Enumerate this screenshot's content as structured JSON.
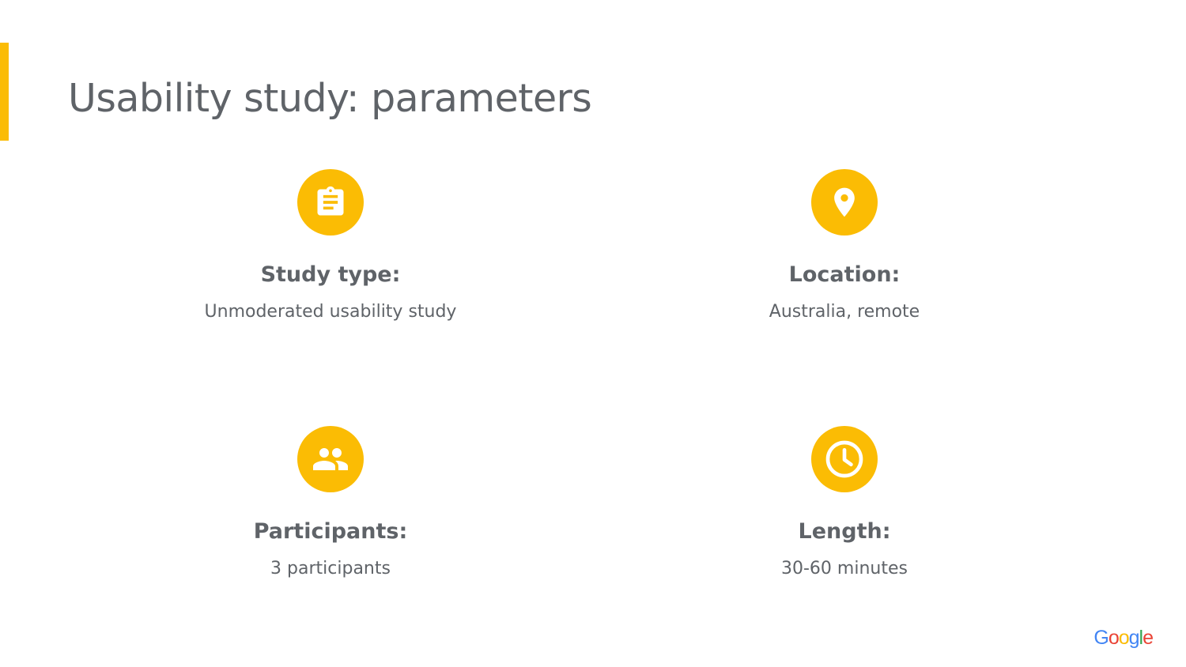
{
  "slide": {
    "title": "Usability study: parameters",
    "accent_color": "#fbbc04"
  },
  "parameters": [
    {
      "label": "Study type:",
      "value": "Unmoderated usability study",
      "icon": "clipboard-icon"
    },
    {
      "label": "Location:",
      "value": "Australia, remote",
      "icon": "location-pin-icon"
    },
    {
      "label": "Participants:",
      "value": "3 participants",
      "icon": "people-icon"
    },
    {
      "label": "Length:",
      "value": "30-60 minutes",
      "icon": "clock-icon"
    }
  ],
  "logo": {
    "letters": [
      "G",
      "o",
      "o",
      "g",
      "l",
      "e"
    ],
    "colors": [
      "#4285f4",
      "#ea4335",
      "#fbbc04",
      "#4285f4",
      "#34a853",
      "#ea4335"
    ]
  }
}
